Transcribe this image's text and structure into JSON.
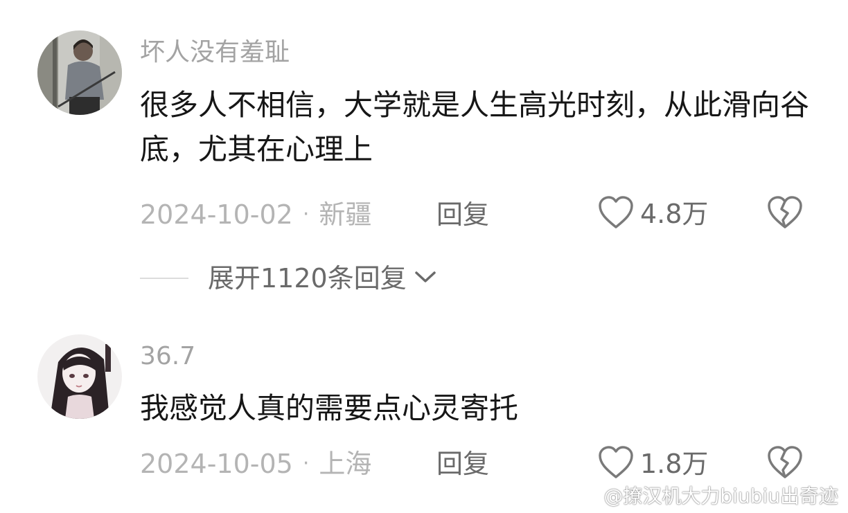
{
  "comments": [
    {
      "username": "坏人没有羞耻",
      "text": "很多人不相信，大学就是人生高光时刻，从此滑向谷底，尤其在心理上",
      "date": "2024-10-02",
      "location": "新疆",
      "reply_label": "回复",
      "likes": "4.8万",
      "expand_label": "展开1120条回复"
    },
    {
      "username": "36.7",
      "text": "我感觉人真的需要点心灵寄托",
      "date": "2024-10-05",
      "location": "上海",
      "reply_label": "回复",
      "likes": "1.8万"
    }
  ],
  "meta_separator": "·",
  "watermark": "@撩汉机大力biubiu出奇迹",
  "colors": {
    "text_primary": "#161616",
    "text_secondary": "#a3a3a3",
    "text_action": "#6a6a6a",
    "background": "#ffffff"
  }
}
